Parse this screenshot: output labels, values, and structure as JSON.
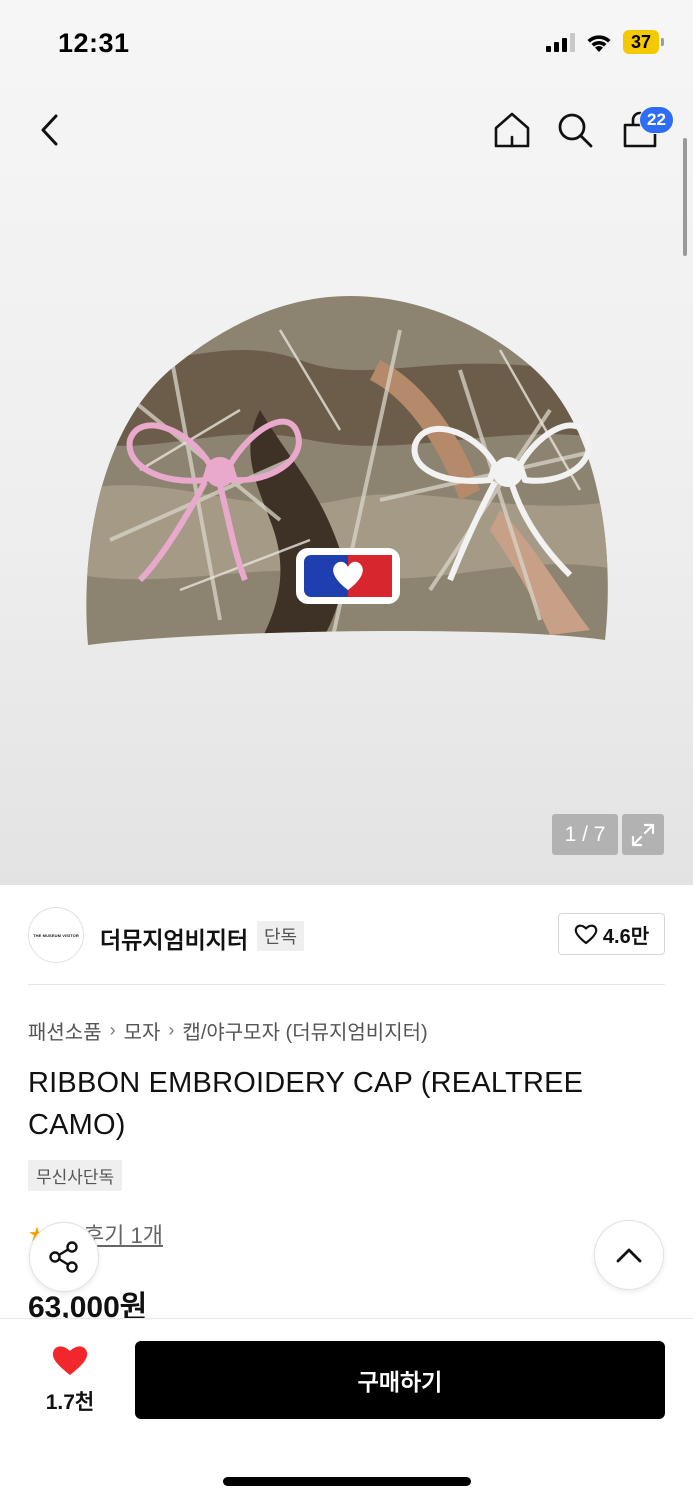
{
  "status": {
    "time": "12:31",
    "battery": "37"
  },
  "nav": {
    "cart_count": "22"
  },
  "gallery": {
    "pager": "1 / 7"
  },
  "brand": {
    "logo_text": "THE MUSEUM VISITOR",
    "name": "더뮤지엄비지터",
    "tag": "단독",
    "likes": "4.6만"
  },
  "breadcrumb": [
    "패션소품",
    "모자",
    "캡/야구모자 (더뮤지엄비지터)"
  ],
  "product": {
    "title": "RIBBON EMBROIDERY CAP (REALTREE CAMO)",
    "badge": "무신사단독",
    "review_label": "후기 1개",
    "price": "63,000원"
  },
  "bottom": {
    "like_count": "1.7천",
    "buy_label": "구매하기"
  },
  "colors": {
    "accent_blue": "#2f6df6",
    "heart_red": "#f1272c",
    "star": "#f4a400",
    "buy_button": "#000000"
  }
}
